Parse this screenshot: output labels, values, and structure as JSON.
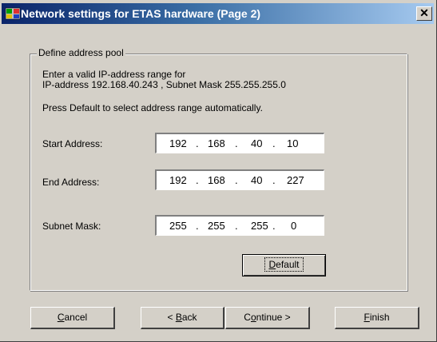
{
  "window": {
    "title": "Network settings for ETAS hardware (Page 2)",
    "close_glyph": "✕"
  },
  "group": {
    "legend": "Define address pool",
    "intro_line1": "Enter a valid IP-address range for",
    "intro_line2": "IP-address 192.168.40.243 , Subnet Mask 255.255.255.0",
    "hint": "Press Default to select address range automatically."
  },
  "start_address": {
    "label": "Start Address:",
    "octets": [
      "192",
      "168",
      "40",
      "10"
    ]
  },
  "end_address": {
    "label": "End Address:",
    "octets": [
      "192",
      "168",
      "40",
      "227"
    ]
  },
  "subnet_mask": {
    "label": "Subnet Mask:",
    "octets": [
      "255",
      "255",
      "255",
      "0"
    ]
  },
  "buttons": {
    "default": {
      "accel": "D",
      "rest": "efault"
    },
    "cancel": {
      "accel": "C",
      "rest": "ancel"
    },
    "back": {
      "pre": "< ",
      "accel": "B",
      "rest": "ack"
    },
    "continue": {
      "pre": "C",
      "accel": "o",
      "rest": "ntinue >"
    },
    "finish": {
      "accel": "F",
      "rest": "inish"
    }
  },
  "icons": {
    "app": "etas-network-icon",
    "close": "close-icon"
  },
  "colors": {
    "titlebar_start": "#0a246a",
    "titlebar_end": "#a6caf0",
    "face": "#d4d0c8"
  }
}
